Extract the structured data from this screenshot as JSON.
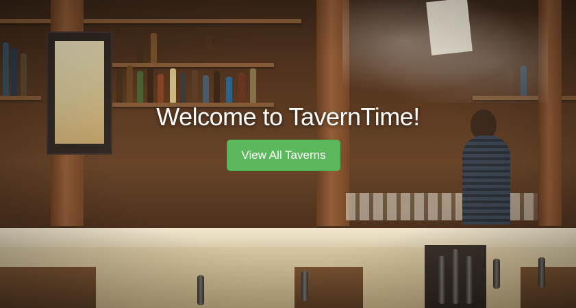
{
  "hero": {
    "headline": "Welcome to TavernTime!",
    "cta_label": "View All Taverns"
  },
  "colors": {
    "cta_background": "#5cb85c",
    "headline_text": "#ffffff"
  },
  "background_image": {
    "icon": "bar-interior-photo"
  }
}
